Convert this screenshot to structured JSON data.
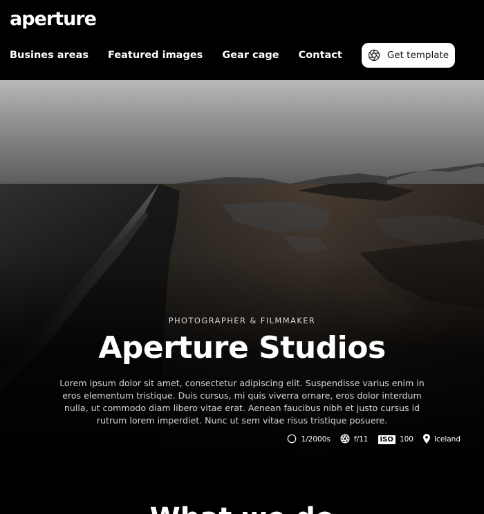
{
  "header": {
    "logo": "aperture",
    "nav": [
      "Busines areas",
      "Featured images",
      "Gear cage",
      "Contact"
    ],
    "cta_label": "Get template"
  },
  "hero": {
    "eyebrow": "PHOTOGRAPHER & FILMMAKER",
    "title": "Aperture Studios",
    "description": "Lorem ipsum dolor sit amet, consectetur adipiscing elit. Suspendisse varius enim in eros elementum tristique. Duis cursus, mi quis viverra ornare, eros dolor interdum nulla, ut commodo diam libero vitae erat. Aenean faucibus nibh et justo cursus id rutrum lorem imperdiet. Nunc ut sem vitae risus tristique posuere.",
    "exif": {
      "shutter": "1/2000s",
      "aperture": "f/11",
      "iso_label": "ISO",
      "iso_value": "100",
      "location": "Iceland"
    }
  },
  "section": {
    "heading": "What we do"
  },
  "icons": [
    "aperture-icon",
    "shutter-icon",
    "aperture-small-icon",
    "location-pin-icon"
  ]
}
